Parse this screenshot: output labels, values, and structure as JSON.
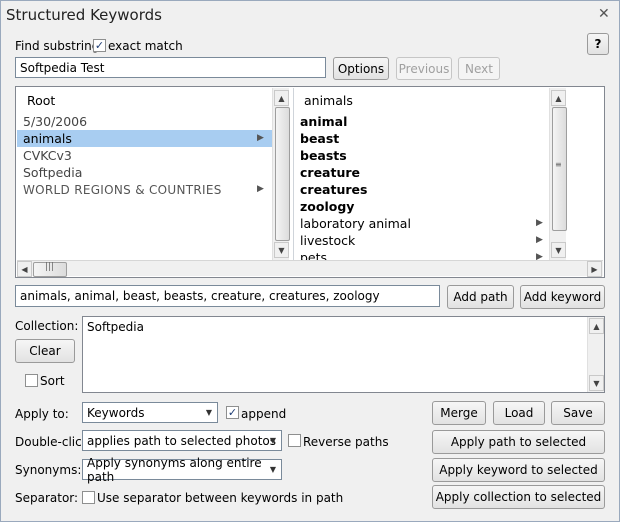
{
  "window": {
    "title": "Structured Keywords",
    "close_glyph": "✕",
    "help_label": "?"
  },
  "find": {
    "label": "Find substring:",
    "exact_match_label": "exact match",
    "exact_match_checked": true,
    "value": "Softpedia Test",
    "options_label": "Options",
    "previous_label": "Previous",
    "next_label": "Next"
  },
  "left_list": {
    "header": "Root",
    "items": [
      {
        "label": "5/30/2006",
        "bold": false,
        "has_children": false,
        "selected": false
      },
      {
        "label": "animals",
        "bold": false,
        "has_children": true,
        "selected": true
      },
      {
        "label": "CVKCv3",
        "bold": false,
        "has_children": false,
        "selected": false
      },
      {
        "label": "Softpedia",
        "bold": false,
        "has_children": false,
        "selected": false
      },
      {
        "label": "WORLD REGIONS & COUNTRIES",
        "bold": false,
        "has_children": true,
        "selected": false
      }
    ]
  },
  "right_list": {
    "header": "animals",
    "items": [
      {
        "label": "animal",
        "bold": true,
        "has_children": false
      },
      {
        "label": "beast",
        "bold": true,
        "has_children": false
      },
      {
        "label": "beasts",
        "bold": true,
        "has_children": false
      },
      {
        "label": "creature",
        "bold": true,
        "has_children": false
      },
      {
        "label": "creatures",
        "bold": true,
        "has_children": false
      },
      {
        "label": "zoology",
        "bold": true,
        "has_children": false
      },
      {
        "label": "laboratory animal",
        "bold": false,
        "has_children": true
      },
      {
        "label": "livestock",
        "bold": false,
        "has_children": true
      },
      {
        "label": "pets",
        "bold": false,
        "has_children": true
      }
    ]
  },
  "path": {
    "value": "animals, animal, beast, beasts, creature, creatures, zoology",
    "add_path_label": "Add path",
    "add_keyword_label": "Add keyword"
  },
  "collection": {
    "label": "Collection:",
    "clear_label": "Clear",
    "sort_label": "Sort",
    "sort_checked": false,
    "value": "Softpedia"
  },
  "apply_to": {
    "label": "Apply to:",
    "value": "Keywords",
    "append_label": "append",
    "append_checked": true,
    "merge_label": "Merge",
    "load_label": "Load",
    "save_label": "Save"
  },
  "double_click": {
    "label": "Double-click:",
    "value": "applies path to selected photos",
    "reverse_label": "Reverse paths",
    "reverse_checked": false,
    "apply_path_label": "Apply path to selected"
  },
  "synonyms": {
    "label": "Synonyms:",
    "value": "Apply synonyms along entire path",
    "apply_keyword_label": "Apply keyword to selected"
  },
  "separator": {
    "label": "Separator:",
    "use_separator_label": "Use separator between keywords in path",
    "use_separator_checked": false,
    "apply_collection_label": "Apply collection to selected"
  },
  "colors": {
    "selection": "#a8cdf1",
    "window_bg": "#f0f0f0",
    "border": "#828790"
  }
}
